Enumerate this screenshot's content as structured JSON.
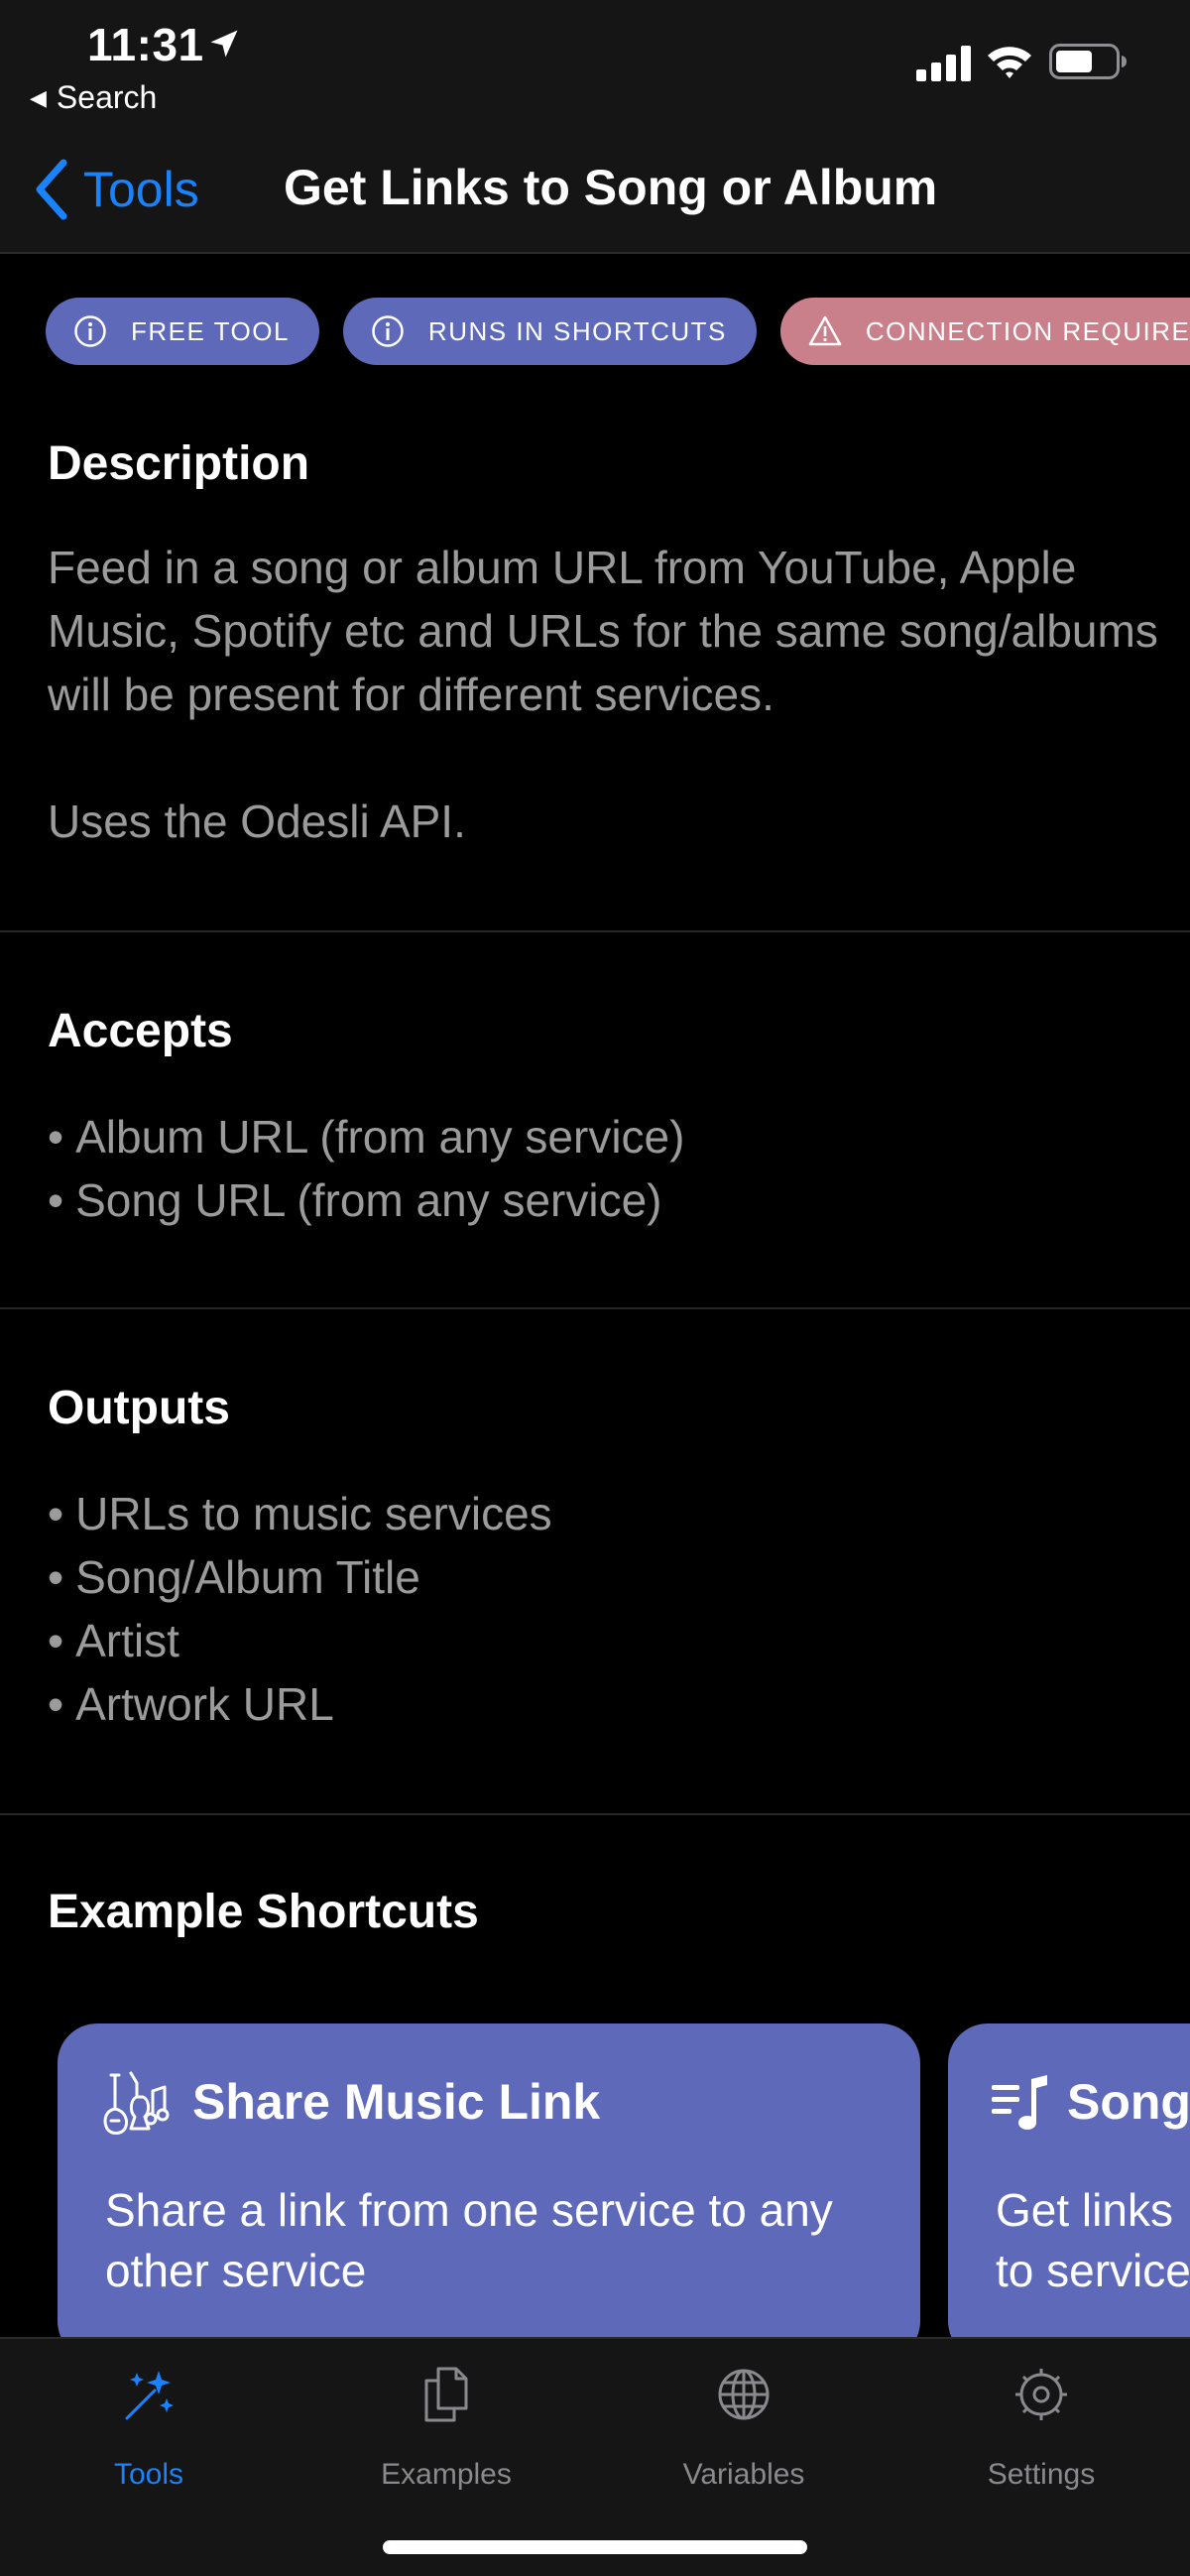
{
  "status_bar": {
    "time": "11:31",
    "back_app": "Search"
  },
  "nav": {
    "back_label": "Tools",
    "title": "Get Links to Song or Album"
  },
  "badges": [
    {
      "label": "FREE TOOL",
      "icon": "info-icon",
      "color": "#5e6ab9"
    },
    {
      "label": "RUNS IN SHORTCUTS",
      "icon": "info-icon",
      "color": "#5e6ab9"
    },
    {
      "label": "CONNECTION REQUIRED",
      "icon": "warning-icon",
      "color": "#c9808b"
    }
  ],
  "description": {
    "title": "Description",
    "paragraph1": "Feed in a song or album URL from YouTube, Apple Music, Spotify etc and URLs for the same song/albums will be present for different services.",
    "paragraph2": "Uses the Odesli API."
  },
  "accepts": {
    "title": "Accepts",
    "items": [
      "Album URL (from any service)",
      "Song URL (from any service)"
    ]
  },
  "outputs": {
    "title": "Outputs",
    "items": [
      "URLs to music services",
      "Song/Album Title",
      "Artist",
      "Artwork URL"
    ]
  },
  "examples": {
    "title": "Example Shortcuts",
    "cards": [
      {
        "title": "Share Music Link",
        "description": "Share a link from one service to any other service",
        "icon": "music-instruments-icon"
      },
      {
        "title": "Song",
        "description": "Get links to service",
        "icon": "music-list-icon"
      }
    ]
  },
  "tab_bar": {
    "tabs": [
      {
        "label": "Tools",
        "icon": "sparkles-icon",
        "active": true
      },
      {
        "label": "Examples",
        "icon": "documents-icon",
        "active": false
      },
      {
        "label": "Variables",
        "icon": "globe-icon",
        "active": false
      },
      {
        "label": "Settings",
        "icon": "gear-icon",
        "active": false
      }
    ]
  },
  "colors": {
    "accent": "#1a82fb",
    "badge_info": "#5e6ab9",
    "badge_warning": "#c9808b",
    "card": "#5e6ab9"
  }
}
